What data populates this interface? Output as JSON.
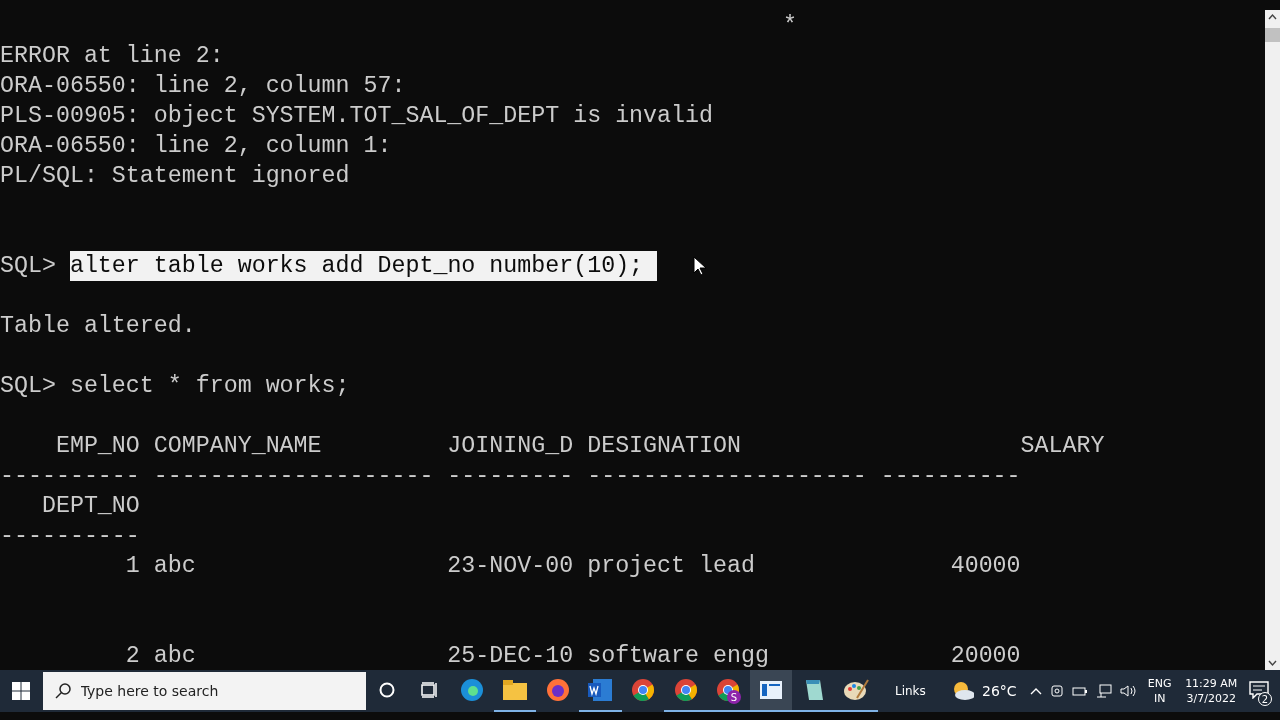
{
  "console": {
    "lines": [
      {
        "kind": "text",
        "text": "                                                        *"
      },
      {
        "kind": "text",
        "text": "ERROR at line 2:"
      },
      {
        "kind": "text",
        "text": "ORA-06550: line 2, column 57:"
      },
      {
        "kind": "text",
        "text": "PLS-00905: object SYSTEM.TOT_SAL_OF_DEPT is invalid"
      },
      {
        "kind": "text",
        "text": "ORA-06550: line 2, column 1:"
      },
      {
        "kind": "text",
        "text": "PL/SQL: Statement ignored"
      },
      {
        "kind": "blank"
      },
      {
        "kind": "blank"
      },
      {
        "kind": "prompt",
        "prompt": "SQL>",
        "text": "alter table works add Dept_no number(10);",
        "selected": true
      },
      {
        "kind": "blank"
      },
      {
        "kind": "text",
        "text": "Table altered."
      },
      {
        "kind": "blank"
      },
      {
        "kind": "prompt",
        "prompt": "SQL>",
        "text": "select * from works;",
        "selected": false
      },
      {
        "kind": "blank"
      },
      {
        "kind": "text",
        "text": "    EMP_NO COMPANY_NAME         JOINING_D DESIGNATION                    SALARY"
      },
      {
        "kind": "text",
        "text": "---------- -------------------- --------- -------------------- ----------"
      },
      {
        "kind": "text",
        "text": "   DEPT_NO"
      },
      {
        "kind": "text",
        "text": "----------"
      },
      {
        "kind": "text",
        "text": "         1 abc                  23-NOV-00 project lead              40000"
      },
      {
        "kind": "blank"
      },
      {
        "kind": "blank"
      },
      {
        "kind": "text",
        "text": "         2 abc                  25-DEC-10 software engg             20000"
      }
    ]
  },
  "taskbar": {
    "search": {
      "placeholder": "Type here to search"
    },
    "apps": [
      {
        "kind": "edge",
        "running": false,
        "selected": false
      },
      {
        "kind": "folder",
        "running": true,
        "selected": false
      },
      {
        "kind": "firefox",
        "running": false,
        "selected": false
      },
      {
        "kind": "word",
        "running": true,
        "selected": false
      },
      {
        "kind": "chrome",
        "running": false,
        "selected": false
      },
      {
        "kind": "chrome",
        "running": true,
        "selected": false
      },
      {
        "kind": "chrome-profile",
        "badge": "S",
        "running": true,
        "selected": false
      },
      {
        "kind": "console",
        "running": true,
        "selected": true
      },
      {
        "kind": "notepad",
        "running": true,
        "selected": false
      },
      {
        "kind": "paint",
        "running": true,
        "selected": false
      }
    ],
    "links": "Links",
    "temperature": "26°C",
    "language": "ENG",
    "region": "IN",
    "time": "11:29 AM",
    "date": "3/7/2022",
    "notifications": "2"
  }
}
